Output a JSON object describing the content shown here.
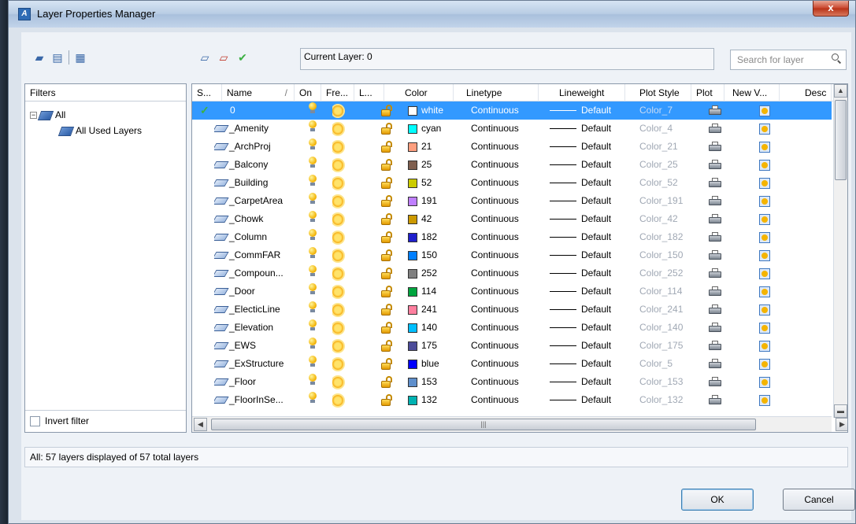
{
  "window": {
    "title": "Layer Properties Manager",
    "close_label": "x"
  },
  "toolbar": {
    "current_layer_label": "Current Layer: 0",
    "search_placeholder": "Search for layer"
  },
  "filters": {
    "header": "Filters",
    "tree": [
      {
        "label": "All",
        "expander": "−"
      },
      {
        "label": "All Used Layers"
      }
    ],
    "invert_filter_label": "Invert filter"
  },
  "grid": {
    "columns": [
      "S...",
      "Name",
      "On",
      "Fre...",
      "L...",
      "Color",
      "Linetype",
      "Lineweight",
      "Plot Style",
      "Plot",
      "New V...",
      "Desc"
    ],
    "rows": [
      {
        "name": "0",
        "color_name": "white",
        "color_hex": "#ffffff",
        "linetype": "Continuous",
        "lineweight": "Default",
        "plot_style": "Color_7",
        "selected": true
      },
      {
        "name": "_Amenity",
        "color_name": "cyan",
        "color_hex": "#00ffff",
        "linetype": "Continuous",
        "lineweight": "Default",
        "plot_style": "Color_4"
      },
      {
        "name": "_ArchProj",
        "color_name": "21",
        "color_hex": "#ff9f7f",
        "linetype": "Continuous",
        "lineweight": "Default",
        "plot_style": "Color_21"
      },
      {
        "name": "_Balcony",
        "color_name": "25",
        "color_hex": "#7f5f4f",
        "linetype": "Continuous",
        "lineweight": "Default",
        "plot_style": "Color_25"
      },
      {
        "name": "_Building",
        "color_name": "52",
        "color_hex": "#cccc00",
        "linetype": "Continuous",
        "lineweight": "Default",
        "plot_style": "Color_52"
      },
      {
        "name": "_CarpetArea",
        "color_name": "191",
        "color_hex": "#bf7fff",
        "linetype": "Continuous",
        "lineweight": "Default",
        "plot_style": "Color_191"
      },
      {
        "name": "_Chowk",
        "color_name": "42",
        "color_hex": "#cc9900",
        "linetype": "Continuous",
        "lineweight": "Default",
        "plot_style": "Color_42"
      },
      {
        "name": "_Column",
        "color_name": "182",
        "color_hex": "#1f1fcc",
        "linetype": "Continuous",
        "lineweight": "Default",
        "plot_style": "Color_182"
      },
      {
        "name": "_CommFAR",
        "color_name": "150",
        "color_hex": "#007fff",
        "linetype": "Continuous",
        "lineweight": "Default",
        "plot_style": "Color_150"
      },
      {
        "name": "_Compoun...",
        "color_name": "252",
        "color_hex": "#808080",
        "linetype": "Continuous",
        "lineweight": "Default",
        "plot_style": "Color_252"
      },
      {
        "name": "_Door",
        "color_name": "114",
        "color_hex": "#00a53f",
        "linetype": "Continuous",
        "lineweight": "Default",
        "plot_style": "Color_114"
      },
      {
        "name": "_ElecticLine",
        "color_name": "241",
        "color_hex": "#ff7f9f",
        "linetype": "Continuous",
        "lineweight": "Default",
        "plot_style": "Color_241"
      },
      {
        "name": "_Elevation",
        "color_name": "140",
        "color_hex": "#00bfff",
        "linetype": "Continuous",
        "lineweight": "Default",
        "plot_style": "Color_140"
      },
      {
        "name": "_EWS",
        "color_name": "175",
        "color_hex": "#4c4c99",
        "linetype": "Continuous",
        "lineweight": "Default",
        "plot_style": "Color_175"
      },
      {
        "name": "_ExStructure",
        "color_name": "blue",
        "color_hex": "#0000ff",
        "linetype": "Continuous",
        "lineweight": "Default",
        "plot_style": "Color_5"
      },
      {
        "name": "_Floor",
        "color_name": "153",
        "color_hex": "#5f8fcc",
        "linetype": "Continuous",
        "lineweight": "Default",
        "plot_style": "Color_153"
      },
      {
        "name": "_FloorInSe...",
        "color_name": "132",
        "color_hex": "#00b2b2",
        "linetype": "Continuous",
        "lineweight": "Default",
        "plot_style": "Color_132"
      }
    ]
  },
  "status": "All:  57 layers displayed of 57 total layers",
  "buttons": {
    "ok": "OK",
    "cancel": "Cancel"
  }
}
